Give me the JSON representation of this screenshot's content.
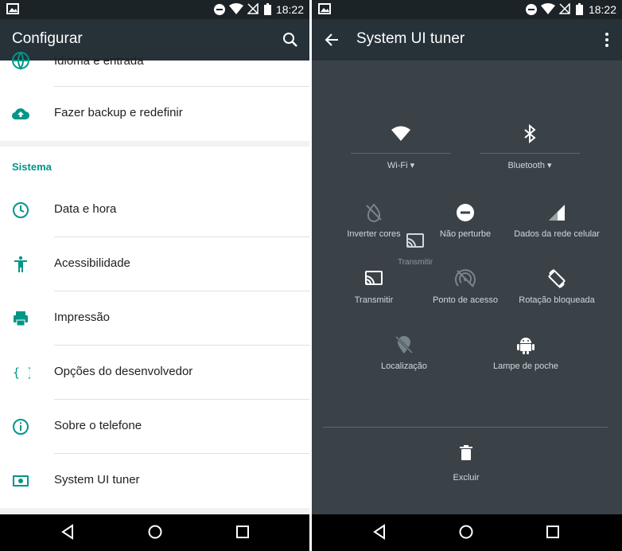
{
  "status": {
    "time": "18:22"
  },
  "left": {
    "title": "Configurar",
    "rows_top": [
      {
        "label": "Idioma e entrada",
        "icon": "globe-icon"
      },
      {
        "label": "Fazer backup e redefinir",
        "icon": "cloud-upload-icon"
      }
    ],
    "section_label": "Sistema",
    "rows": [
      {
        "label": "Data e hora",
        "icon": "clock-icon"
      },
      {
        "label": "Acessibilidade",
        "icon": "accessibility-icon"
      },
      {
        "label": "Impressão",
        "icon": "printer-icon"
      },
      {
        "label": "Opções do desenvolvedor",
        "icon": "braces-icon"
      },
      {
        "label": "Sobre o telefone",
        "icon": "info-icon"
      },
      {
        "label": "System UI tuner",
        "icon": "tuner-icon"
      }
    ],
    "accent": "#009688"
  },
  "right": {
    "title": "System UI tuner",
    "big_tiles": [
      {
        "label": "Wi-Fi",
        "icon": "wifi-icon"
      },
      {
        "label": "Bluetooth",
        "icon": "bluetooth-icon"
      }
    ],
    "tiles": [
      {
        "label": "Inverter cores",
        "icon": "invert-colors-icon"
      },
      {
        "label": "Não perturbe",
        "icon": "do-not-disturb-icon"
      },
      {
        "label": "Dados da rede celular",
        "icon": "cell-signal-icon"
      },
      {
        "label": "Transmitir",
        "icon": "cast-icon"
      },
      {
        "label": "Ponto de acesso",
        "icon": "hotspot-icon"
      },
      {
        "label": "Rotação bloqueada",
        "icon": "rotation-lock-icon"
      },
      {
        "label": "Localização",
        "icon": "location-off-icon"
      },
      {
        "label": "Lampe de poche",
        "icon": "android-icon"
      }
    ],
    "dragging_tile": {
      "label": "Transmitir",
      "icon": "cast-icon"
    },
    "delete_label": "Excluir"
  }
}
